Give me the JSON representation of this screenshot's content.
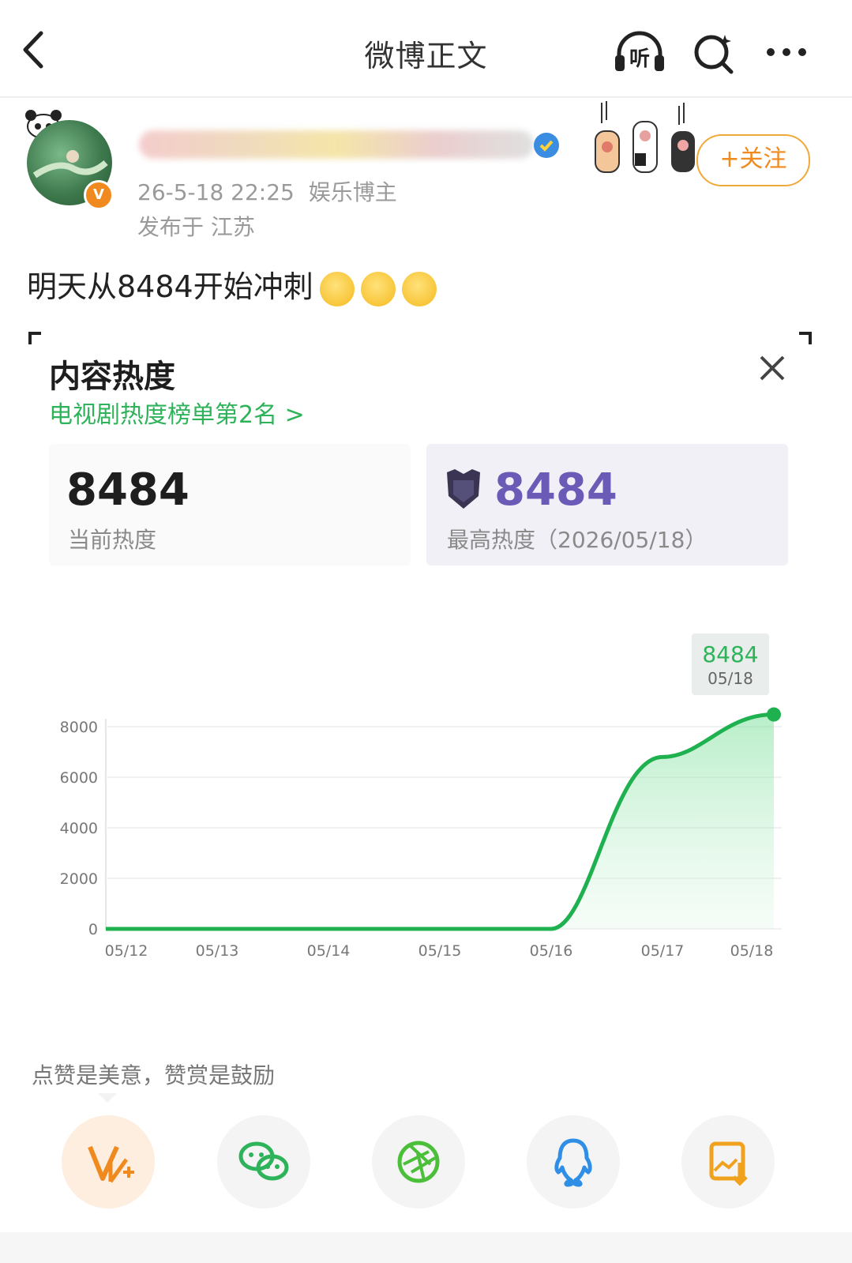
{
  "nav": {
    "title": "微博正文",
    "listen_label": "听"
  },
  "author": {
    "avatar_badge": "V",
    "timestamp": "26-5-18 22:25",
    "category": "娱乐博主",
    "location": "发布于 江苏",
    "follow_label": "+关注"
  },
  "post": {
    "text": "明天从8484开始冲刺"
  },
  "heat_card": {
    "title": "内容热度",
    "rank_link": "电视剧热度榜单第2名 >",
    "current_value": "8484",
    "current_label": "当前热度",
    "peak_value": "8484",
    "peak_label": "最高热度（2026/05/18）",
    "tooltip_value": "8484",
    "tooltip_date": "05/18"
  },
  "chart_data": {
    "type": "area",
    "x": [
      "05/12",
      "05/13",
      "05/14",
      "05/15",
      "05/16",
      "05/17",
      "05/18"
    ],
    "y": [
      0,
      0,
      0,
      0,
      0,
      6800,
      8484
    ],
    "yticks": [
      "0",
      "2000",
      "4000",
      "6000",
      "8000"
    ],
    "ylim": [
      0,
      8000
    ],
    "grid": true,
    "color": "#1fb150"
  },
  "footer": {
    "tip": "点赞是美意，赞赏是鼓励"
  },
  "colors": {
    "accent_orange": "#f08a1e",
    "green": "#2fb35a",
    "purple": "#6b5bb6"
  }
}
